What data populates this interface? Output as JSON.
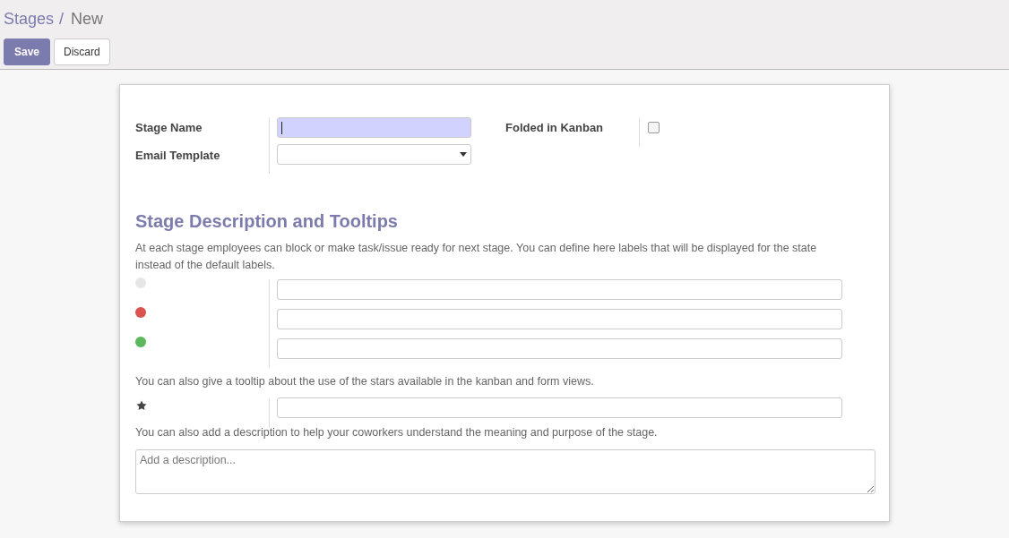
{
  "breadcrumb": {
    "parent": "Stages",
    "separator": "/",
    "current": "New"
  },
  "buttons": [
    {
      "label": "Save",
      "kind": "primary"
    },
    {
      "label": "Discard",
      "kind": "secondary"
    }
  ],
  "form": {
    "stage_name": {
      "label": "Stage Name",
      "focused": true
    },
    "email_template": {
      "label": "Email Template"
    },
    "folded_in_kanban": {
      "label": "Folded in Kanban",
      "checked": false
    }
  },
  "section": {
    "title": "Stage Description and Tooltips",
    "intro": "At each stage employees can block or make task/issue ready for next stage. You can define here labels that will be displayed for the state instead of the default labels.",
    "state_labels": [
      {
        "color": "#e6e6e6"
      },
      {
        "color": "#d9534f"
      },
      {
        "color": "#5cb85c"
      }
    ],
    "stars_note": "You can also give a tooltip about the use of the stars available in the kanban and form views.",
    "description_note": "You can also add a description to help your coworkers understand the meaning and purpose of the stage.",
    "description": {
      "placeholder": "Add a description..."
    }
  }
}
